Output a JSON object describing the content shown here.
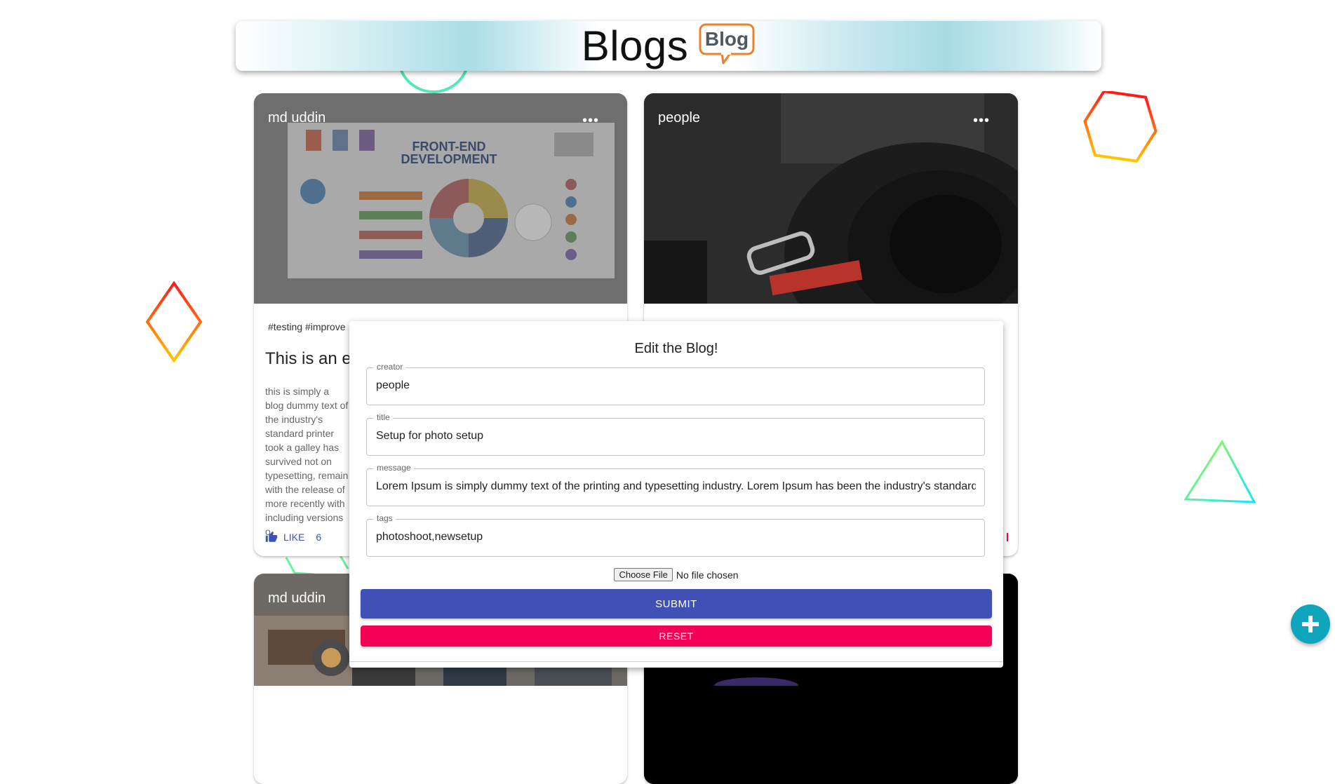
{
  "header": {
    "title": "Blogs",
    "logo_text": "Blog"
  },
  "cards": [
    {
      "author": "md uddin",
      "more_label": "•••",
      "media_headline_1": "FRONT-END",
      "media_headline_2": "DEVELOPMENT",
      "tags": "#testing #improve",
      "title": "This is an e",
      "message": "this is simply a blog dummy text of the industry's standard printer took a galley has survived not on typesetting, remain with the release of more recently with including versions o",
      "like_label": "LIKE",
      "like_count": "6"
    },
    {
      "author": "people",
      "more_label": "•••"
    },
    {
      "author": "md uddin"
    },
    {
      "author": ""
    }
  ],
  "edit_form": {
    "heading": "Edit the Blog!",
    "fields": {
      "creator": {
        "label": "creator",
        "value": "people"
      },
      "title": {
        "label": "title",
        "value": "Setup for photo setup"
      },
      "message": {
        "label": "message",
        "value": "Lorem Ipsum is simply dummy text of the printing and typesetting industry. Lorem Ipsum has been the industry's standard"
      },
      "tags": {
        "label": "tags",
        "value": "photoshoot,newsetup"
      }
    },
    "file": {
      "button_label": "Choose File",
      "status": "No file chosen"
    },
    "submit_label": "SUBMIT",
    "reset_label": "RESET"
  },
  "fab": {
    "icon": "plus-icon"
  },
  "colors": {
    "primary": "#3f51b5",
    "secondary": "#f50057",
    "fab": "#0ea5bd"
  }
}
